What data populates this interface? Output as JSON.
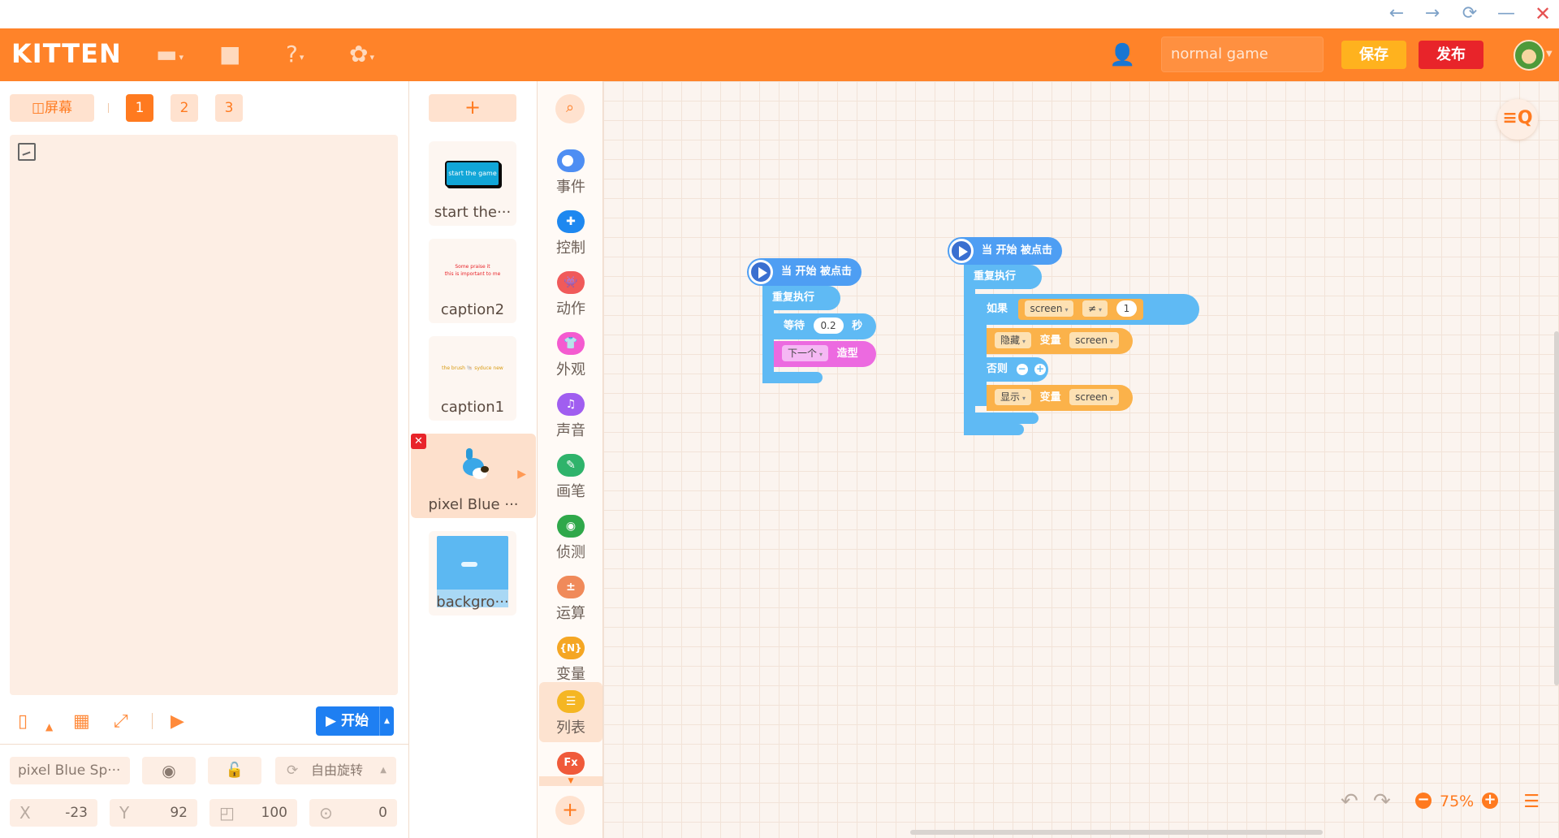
{
  "window": {
    "back": "←",
    "forward": "→",
    "refresh": "⟳",
    "minimize": "—",
    "close": "✕"
  },
  "header": {
    "logo": "KITTEN",
    "game_name": "normal game",
    "save_label": "保存",
    "publish_label": "发布"
  },
  "stage": {
    "screen_label": "屏幕",
    "scenes": [
      "1",
      "2",
      "3"
    ],
    "start_label": "开始",
    "sprite_name": "pixel Blue Sp···",
    "rotation_label": "自由旋转",
    "x_label": "X",
    "x_value": "-23",
    "y_label": "Y",
    "y_value": "92",
    "size_value": "100",
    "direction_value": "0"
  },
  "sprites": {
    "add_label": "+",
    "items": [
      {
        "name": "start the···",
        "thumb_text": "start the game"
      },
      {
        "name": "caption2",
        "thumb_text": "Some praise it\nthis is important to me"
      },
      {
        "name": "caption1",
        "thumb_text": "the brush 🐚 syduce new"
      },
      {
        "name": "pixel Blue ···"
      },
      {
        "name": "backgro···"
      }
    ]
  },
  "categories": [
    {
      "label": "事件",
      "color": "#4e8ef3",
      "glyph": ""
    },
    {
      "label": "控制",
      "color": "#1e88f0",
      "glyph": "✚"
    },
    {
      "label": "动作",
      "color": "#f05a5a",
      "glyph": "👾"
    },
    {
      "label": "外观",
      "color": "#f45bd0",
      "glyph": "👕"
    },
    {
      "label": "声音",
      "color": "#a05ef0",
      "glyph": "♫"
    },
    {
      "label": "画笔",
      "color": "#2fb36b",
      "glyph": "✎"
    },
    {
      "label": "侦测",
      "color": "#2fa84a",
      "glyph": "◉"
    },
    {
      "label": "运算",
      "color": "#f08a5a",
      "glyph": "±"
    },
    {
      "label": "变量",
      "color": "#f5a623",
      "glyph": "{N}"
    },
    {
      "label": "列表",
      "color": "#f5b623",
      "glyph": "☰"
    }
  ],
  "fx_label": "Fx",
  "workspace": {
    "zoom": "75%",
    "script1": {
      "hat": "当 开始 被点击",
      "loop": "重复执行",
      "wait": "等待",
      "wait_value": "0.2",
      "wait_unit": "秒",
      "next": "下一个",
      "costume": "造型"
    },
    "script2": {
      "hat": "当 开始 被点击",
      "loop": "重复执行",
      "if": "如果",
      "var": "screen",
      "op": "≠",
      "value": "1",
      "hide": "隐藏",
      "var_label": "变量",
      "var_name": "screen",
      "else": "否则",
      "show": "显示"
    }
  }
}
